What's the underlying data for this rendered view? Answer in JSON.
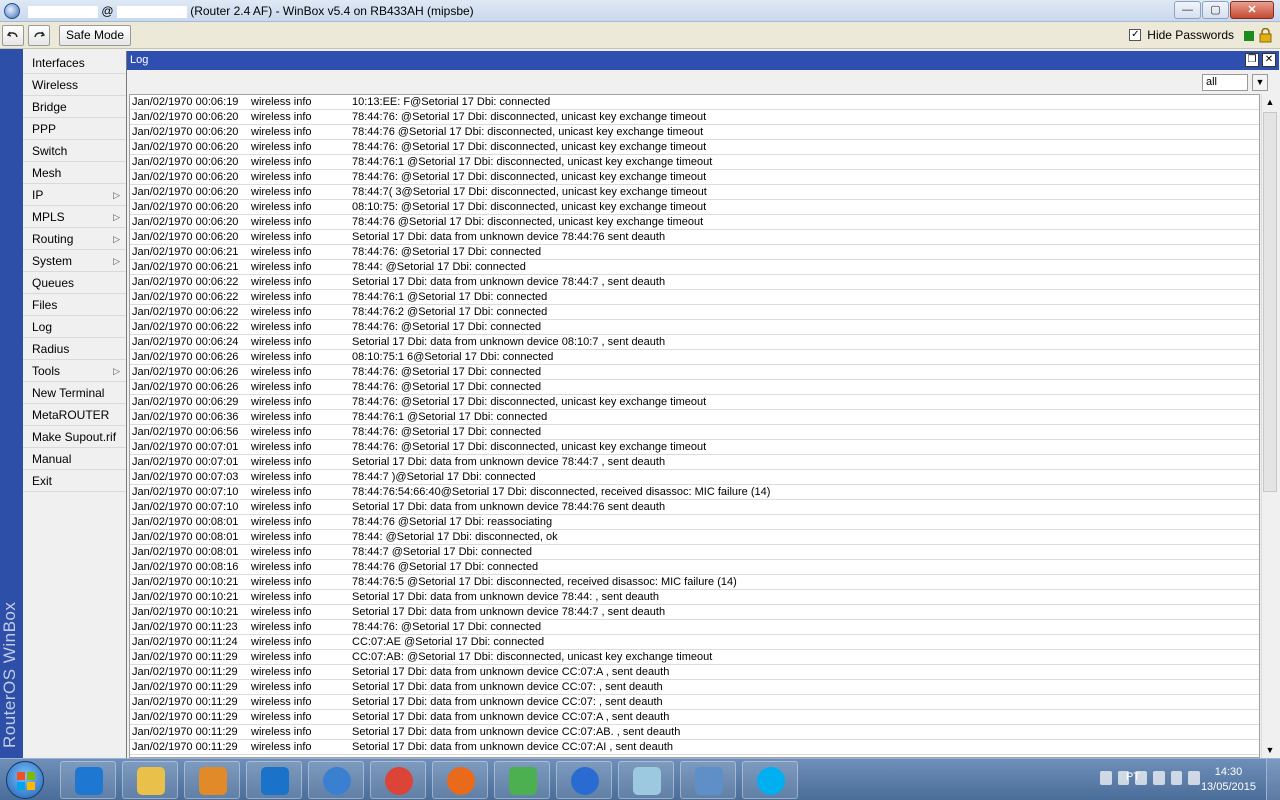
{
  "window": {
    "title_prefix": "@",
    "title_rest": "(Router 2.4 AF) - WinBox v5.4 on RB433AH (mipsbe)",
    "minimize": "—",
    "maximize": "▢",
    "close": "✕"
  },
  "toolbar": {
    "undo_icon": "undo-icon",
    "redo_icon": "redo-icon",
    "safe_mode": "Safe Mode",
    "hide_passwords": "Hide Passwords",
    "hide_passwords_checked": true
  },
  "brand": "RouterOS WinBox",
  "sidebar": {
    "items": [
      {
        "label": "Interfaces",
        "submenu": false
      },
      {
        "label": "Wireless",
        "submenu": false
      },
      {
        "label": "Bridge",
        "submenu": false
      },
      {
        "label": "PPP",
        "submenu": false
      },
      {
        "label": "Switch",
        "submenu": false
      },
      {
        "label": "Mesh",
        "submenu": false
      },
      {
        "label": "IP",
        "submenu": true
      },
      {
        "label": "MPLS",
        "submenu": true
      },
      {
        "label": "Routing",
        "submenu": true
      },
      {
        "label": "System",
        "submenu": true
      },
      {
        "label": "Queues",
        "submenu": false
      },
      {
        "label": "Files",
        "submenu": false
      },
      {
        "label": "Log",
        "submenu": false
      },
      {
        "label": "Radius",
        "submenu": false
      },
      {
        "label": "Tools",
        "submenu": true
      },
      {
        "label": "New Terminal",
        "submenu": false
      },
      {
        "label": "MetaROUTER",
        "submenu": false
      },
      {
        "label": "Make Supout.rif",
        "submenu": false
      },
      {
        "label": "Manual",
        "submenu": false
      },
      {
        "label": "Exit",
        "submenu": false
      }
    ]
  },
  "log": {
    "title": "Log",
    "filter_value": "all",
    "rows": [
      {
        "time": "Jan/02/1970 00:06:19",
        "topics": "wireless info",
        "message": "10:13:EE:  F@Setorial 17 Dbi: connected"
      },
      {
        "time": "Jan/02/1970 00:06:20",
        "topics": "wireless info",
        "message": "78:44:76:  @Setorial 17 Dbi: disconnected, unicast key exchange timeout"
      },
      {
        "time": "Jan/02/1970 00:06:20",
        "topics": "wireless info",
        "message": "78:44:76  @Setorial 17 Dbi: disconnected, unicast key exchange timeout"
      },
      {
        "time": "Jan/02/1970 00:06:20",
        "topics": "wireless info",
        "message": "78:44:76:  @Setorial 17 Dbi: disconnected, unicast key exchange timeout"
      },
      {
        "time": "Jan/02/1970 00:06:20",
        "topics": "wireless info",
        "message": "78:44:76:1  @Setorial 17 Dbi: disconnected, unicast key exchange timeout"
      },
      {
        "time": "Jan/02/1970 00:06:20",
        "topics": "wireless info",
        "message": "78:44:76:  @Setorial 17 Dbi: disconnected, unicast key exchange timeout"
      },
      {
        "time": "Jan/02/1970 00:06:20",
        "topics": "wireless info",
        "message": "78:44:7(  3@Setorial 17 Dbi: disconnected, unicast key exchange timeout"
      },
      {
        "time": "Jan/02/1970 00:06:20",
        "topics": "wireless info",
        "message": "08:10:75:  @Setorial 17 Dbi: disconnected, unicast key exchange timeout"
      },
      {
        "time": "Jan/02/1970 00:06:20",
        "topics": "wireless info",
        "message": "78:44:76  @Setorial 17 Dbi: disconnected, unicast key exchange timeout"
      },
      {
        "time": "Jan/02/1970 00:06:20",
        "topics": "wireless info",
        "message": "Setorial 17 Dbi: data from unknown device 78:44:76  sent deauth"
      },
      {
        "time": "Jan/02/1970 00:06:21",
        "topics": "wireless info",
        "message": "78:44:76:  @Setorial 17 Dbi: connected"
      },
      {
        "time": "Jan/02/1970 00:06:21",
        "topics": "wireless info",
        "message": "78:44:  @Setorial 17 Dbi: connected"
      },
      {
        "time": "Jan/02/1970 00:06:22",
        "topics": "wireless info",
        "message": "Setorial 17 Dbi: data from unknown device 78:44:7  , sent deauth"
      },
      {
        "time": "Jan/02/1970 00:06:22",
        "topics": "wireless info",
        "message": "78:44:76:1  @Setorial 17 Dbi: connected"
      },
      {
        "time": "Jan/02/1970 00:06:22",
        "topics": "wireless info",
        "message": "78:44:76:2  @Setorial 17 Dbi: connected"
      },
      {
        "time": "Jan/02/1970 00:06:22",
        "topics": "wireless info",
        "message": "78:44:76:  @Setorial 17 Dbi: connected"
      },
      {
        "time": "Jan/02/1970 00:06:24",
        "topics": "wireless info",
        "message": "Setorial 17 Dbi: data from unknown device 08:10:7  , sent deauth"
      },
      {
        "time": "Jan/02/1970 00:06:26",
        "topics": "wireless info",
        "message": "08:10:75:1  6@Setorial 17 Dbi: connected"
      },
      {
        "time": "Jan/02/1970 00:06:26",
        "topics": "wireless info",
        "message": "78:44:76:  @Setorial 17 Dbi: connected"
      },
      {
        "time": "Jan/02/1970 00:06:26",
        "topics": "wireless info",
        "message": "78:44:76:  @Setorial 17 Dbi: connected"
      },
      {
        "time": "Jan/02/1970 00:06:29",
        "topics": "wireless info",
        "message": "78:44:76:  @Setorial 17 Dbi: disconnected, unicast key exchange timeout"
      },
      {
        "time": "Jan/02/1970 00:06:36",
        "topics": "wireless info",
        "message": "78:44:76:1  @Setorial 17 Dbi: connected"
      },
      {
        "time": "Jan/02/1970 00:06:56",
        "topics": "wireless info",
        "message": "78:44:76:  @Setorial 17 Dbi: connected"
      },
      {
        "time": "Jan/02/1970 00:07:01",
        "topics": "wireless info",
        "message": "78:44:76:  @Setorial 17 Dbi: disconnected, unicast key exchange timeout"
      },
      {
        "time": "Jan/02/1970 00:07:01",
        "topics": "wireless info",
        "message": "Setorial 17 Dbi: data from unknown device 78:44:7  , sent deauth"
      },
      {
        "time": "Jan/02/1970 00:07:03",
        "topics": "wireless info",
        "message": "78:44:7  )@Setorial 17 Dbi: connected"
      },
      {
        "time": "Jan/02/1970 00:07:10",
        "topics": "wireless info",
        "message": "78:44:76:54:66:40@Setorial 17 Dbi: disconnected, received disassoc: MIC failure (14)"
      },
      {
        "time": "Jan/02/1970 00:07:10",
        "topics": "wireless info",
        "message": "Setorial 17 Dbi: data from unknown device 78:44:76  sent deauth"
      },
      {
        "time": "Jan/02/1970 00:08:01",
        "topics": "wireless info",
        "message": "78:44:76  @Setorial 17 Dbi: reassociating"
      },
      {
        "time": "Jan/02/1970 00:08:01",
        "topics": "wireless info",
        "message": "78:44:  @Setorial 17 Dbi: disconnected, ok"
      },
      {
        "time": "Jan/02/1970 00:08:01",
        "topics": "wireless info",
        "message": "78:44:7  @Setorial 17 Dbi: connected"
      },
      {
        "time": "Jan/02/1970 00:08:16",
        "topics": "wireless info",
        "message": "78:44:76  @Setorial 17 Dbi: connected"
      },
      {
        "time": "Jan/02/1970 00:10:21",
        "topics": "wireless info",
        "message": "78:44:76:5  @Setorial 17 Dbi: disconnected, received disassoc: MIC failure (14)"
      },
      {
        "time": "Jan/02/1970 00:10:21",
        "topics": "wireless info",
        "message": "Setorial 17 Dbi: data from unknown device 78:44:  , sent deauth"
      },
      {
        "time": "Jan/02/1970 00:10:21",
        "topics": "wireless info",
        "message": "Setorial 17 Dbi: data from unknown device 78:44:7  , sent deauth"
      },
      {
        "time": "Jan/02/1970 00:11:23",
        "topics": "wireless info",
        "message": "78:44:76:  @Setorial 17 Dbi: connected"
      },
      {
        "time": "Jan/02/1970 00:11:24",
        "topics": "wireless info",
        "message": "CC:07:AE  @Setorial 17 Dbi: connected"
      },
      {
        "time": "Jan/02/1970 00:11:29",
        "topics": "wireless info",
        "message": "CC:07:AB:  @Setorial 17 Dbi: disconnected, unicast key exchange timeout"
      },
      {
        "time": "Jan/02/1970 00:11:29",
        "topics": "wireless info",
        "message": "Setorial 17 Dbi: data from unknown device CC:07:A  , sent deauth"
      },
      {
        "time": "Jan/02/1970 00:11:29",
        "topics": "wireless info",
        "message": "Setorial 17 Dbi: data from unknown device CC:07:  , sent deauth"
      },
      {
        "time": "Jan/02/1970 00:11:29",
        "topics": "wireless info",
        "message": "Setorial 17 Dbi: data from unknown device CC:07:  , sent deauth"
      },
      {
        "time": "Jan/02/1970 00:11:29",
        "topics": "wireless info",
        "message": "Setorial 17 Dbi: data from unknown device CC:07:A  , sent deauth"
      },
      {
        "time": "Jan/02/1970 00:11:29",
        "topics": "wireless info",
        "message": "Setorial 17 Dbi: data from unknown device CC:07:AB.  , sent deauth"
      },
      {
        "time": "Jan/02/1970 00:11:29",
        "topics": "wireless info",
        "message": "Setorial 17 Dbi: data from unknown device CC:07:AI  , sent deauth"
      }
    ]
  },
  "taskbar": {
    "apps": [
      "internet-explorer-icon",
      "file-explorer-icon",
      "media-player-icon",
      "teamviewer-icon",
      "winbox-icon",
      "chrome-icon",
      "firefox-icon",
      "game-icon",
      "google-earth-icon",
      "notepad-icon",
      "control-panel-icon",
      "skype-icon"
    ],
    "lang": "PT",
    "time": "14:30",
    "date": "13/05/2015"
  }
}
